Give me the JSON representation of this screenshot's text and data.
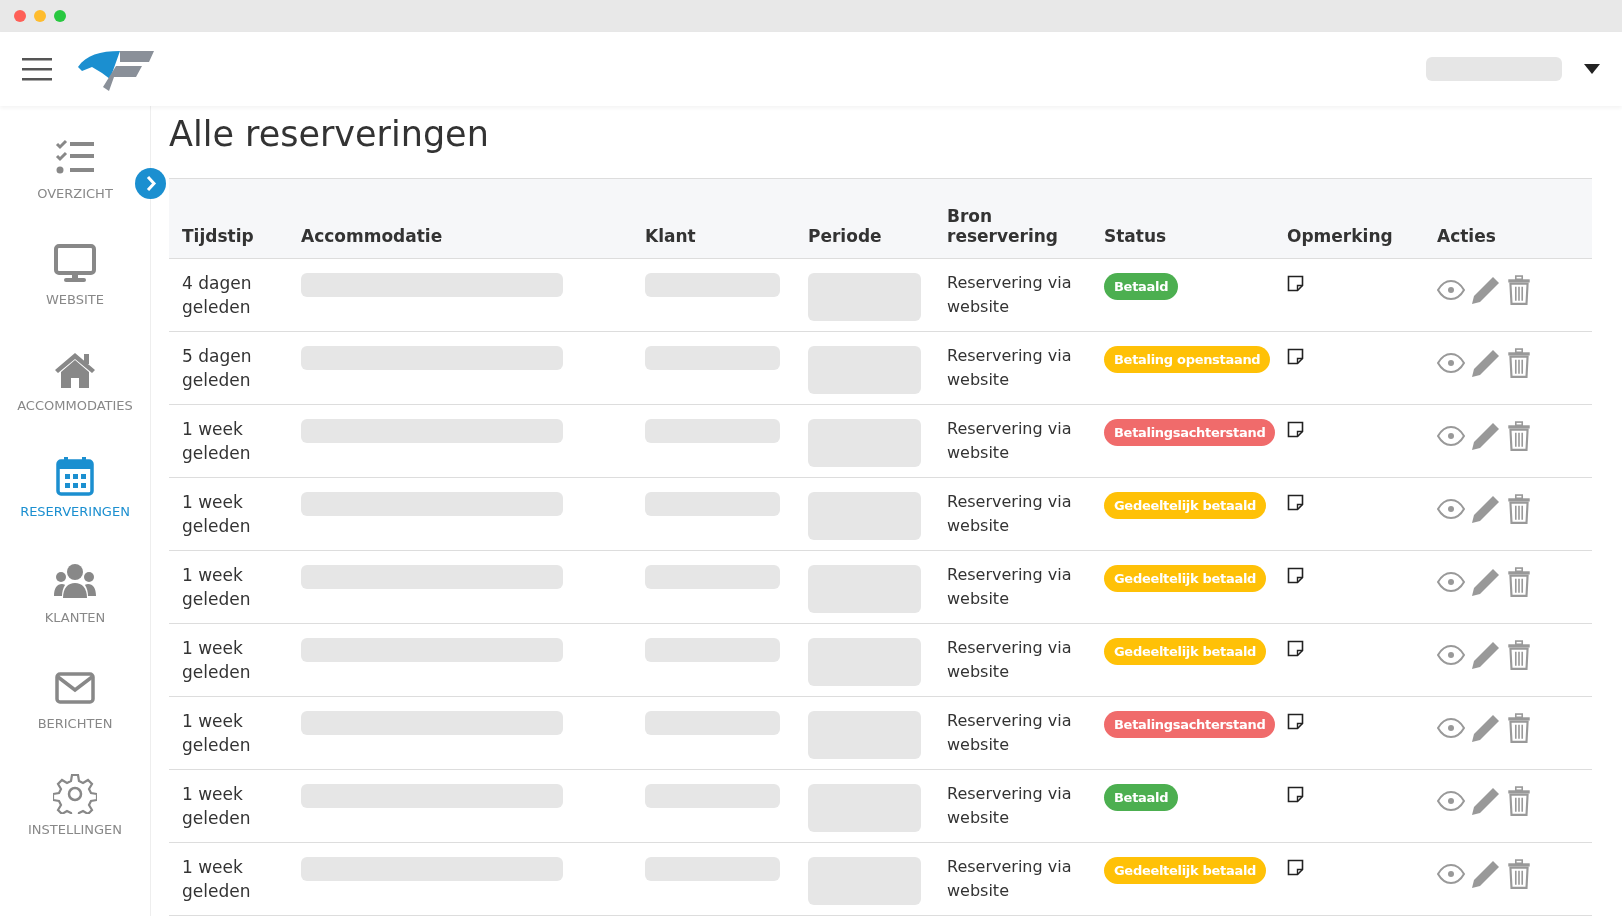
{
  "page": {
    "title": "Alle reserveringen"
  },
  "sidebar": {
    "items": [
      {
        "label": "OVERZICHT",
        "kind": "checklist",
        "selected": false
      },
      {
        "label": "WEBSITE",
        "kind": "monitor",
        "selected": false
      },
      {
        "label": "ACCOMMODATIES",
        "kind": "house",
        "selected": false
      },
      {
        "label": "RESERVERINGEN",
        "kind": "calendar",
        "selected": true
      },
      {
        "label": "KLANTEN",
        "kind": "users",
        "selected": false
      },
      {
        "label": "BERICHTEN",
        "kind": "envelope",
        "selected": false
      },
      {
        "label": "INSTELLINGEN",
        "kind": "gear",
        "selected": false
      }
    ]
  },
  "table": {
    "columns": [
      "Tijdstip",
      "Accommodatie",
      "Klant",
      "Periode",
      "Bron reservering",
      "Status",
      "Opmerking",
      "Acties"
    ],
    "rows": [
      {
        "time": "4 dagen geleden",
        "source": "Reservering via website",
        "status": "Betaald",
        "color": "#4caf50"
      },
      {
        "time": "5 dagen geleden",
        "source": "Reservering via website",
        "status": "Betaling openstaand",
        "color": "#ffc107"
      },
      {
        "time": "1 week geleden",
        "source": "Reservering via website",
        "status": "Betalingsachterstand",
        "color": "#f06b6b"
      },
      {
        "time": "1 week geleden",
        "source": "Reservering via website",
        "status": "Gedeeltelijk betaald",
        "color": "#ffc107"
      },
      {
        "time": "1 week geleden",
        "source": "Reservering via website",
        "status": "Gedeeltelijk betaald",
        "color": "#ffc107"
      },
      {
        "time": "1 week geleden",
        "source": "Reservering via website",
        "status": "Gedeeltelijk betaald",
        "color": "#ffc107"
      },
      {
        "time": "1 week geleden",
        "source": "Reservering via website",
        "status": "Betalingsachterstand",
        "color": "#f06b6b"
      },
      {
        "time": "1 week geleden",
        "source": "Reservering via website",
        "status": "Betaald",
        "color": "#4caf50"
      },
      {
        "time": "1 week geleden",
        "source": "Reservering via website",
        "status": "Gedeeltelijk betaald",
        "color": "#ffc107"
      }
    ]
  }
}
